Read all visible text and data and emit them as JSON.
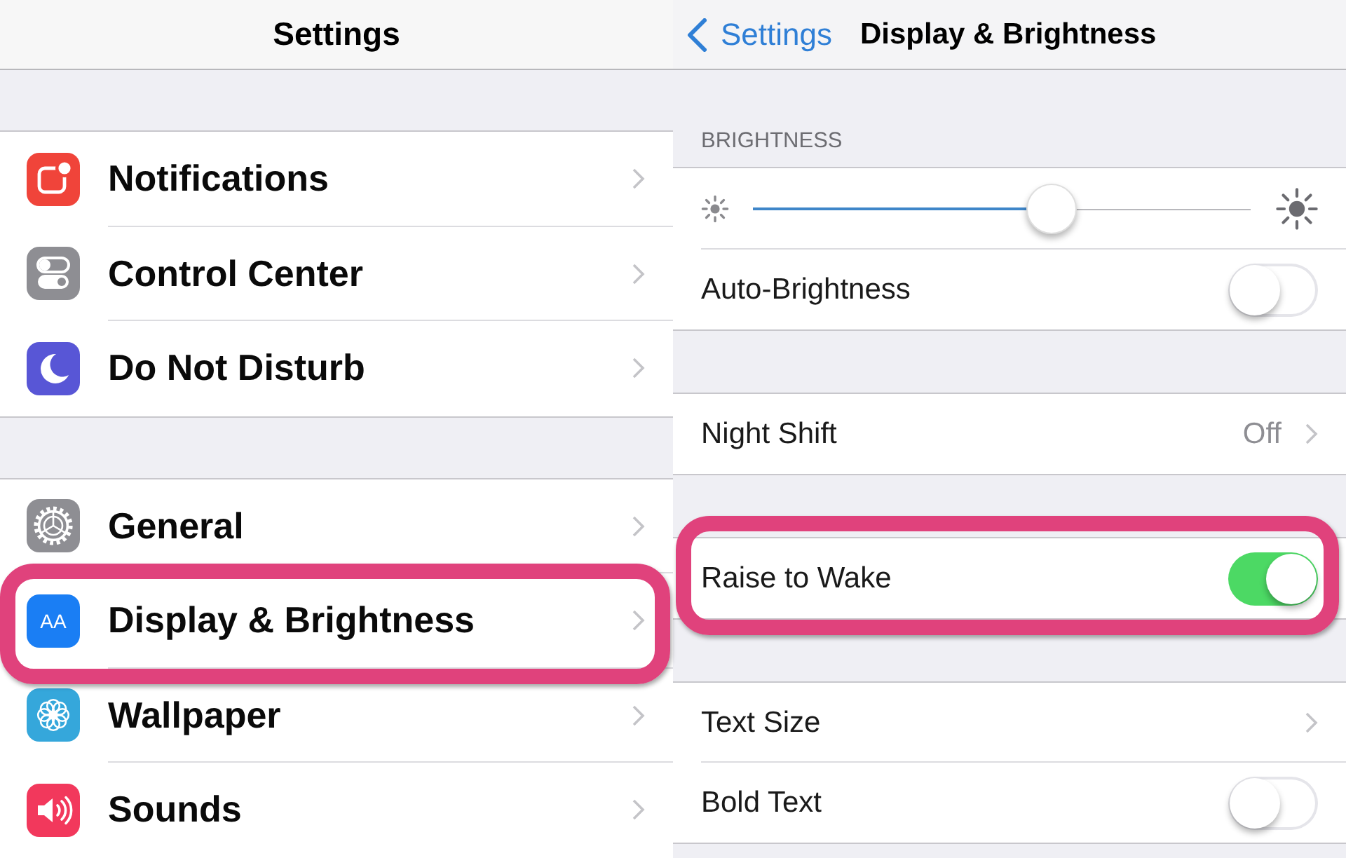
{
  "left_panel": {
    "nav_title": "Settings",
    "groups": [
      {
        "items": [
          {
            "kind": "badge",
            "color": "#f0443a",
            "label": "Notifications",
            "highlighted": false
          },
          {
            "kind": "toggles",
            "color": "#8e8e93",
            "label": "Control Center",
            "highlighted": false
          },
          {
            "kind": "moon",
            "color": "#5856d6",
            "label": "Do Not Disturb",
            "highlighted": false
          }
        ]
      },
      {
        "items": [
          {
            "kind": "gear",
            "color": "#8e8e93",
            "label": "General",
            "highlighted": false
          },
          {
            "kind": "letters",
            "color": "#1a7ef4",
            "icon_text": "AA",
            "label": "Display & Brightness",
            "highlighted": true
          },
          {
            "kind": "flower",
            "color": "#35a7db",
            "label": "Wallpaper",
            "highlighted": false
          },
          {
            "kind": "speaker",
            "color": "#f2385c",
            "label": "Sounds",
            "highlighted": false
          }
        ]
      }
    ]
  },
  "right_panel": {
    "back_label": "Settings",
    "nav_title": "Display & Brightness",
    "sections": [
      {
        "header": "BRIGHTNESS",
        "rows": [
          {
            "kind": "slider",
            "level": 0.6,
            "highlighted": false
          },
          {
            "kind": "toggle",
            "label": "Auto-Brightness",
            "on": false,
            "highlighted": false
          }
        ]
      },
      {
        "rows": [
          {
            "kind": "link",
            "label": "Night Shift",
            "value": "Off",
            "highlighted": false
          }
        ]
      },
      {
        "rows": [
          {
            "kind": "toggle",
            "label": "Raise to Wake",
            "on": true,
            "highlighted": true
          }
        ]
      },
      {
        "rows": [
          {
            "kind": "link",
            "label": "Text Size",
            "highlighted": false
          },
          {
            "kind": "toggle",
            "label": "Bold Text",
            "on": false,
            "highlighted": false
          }
        ]
      }
    ]
  }
}
